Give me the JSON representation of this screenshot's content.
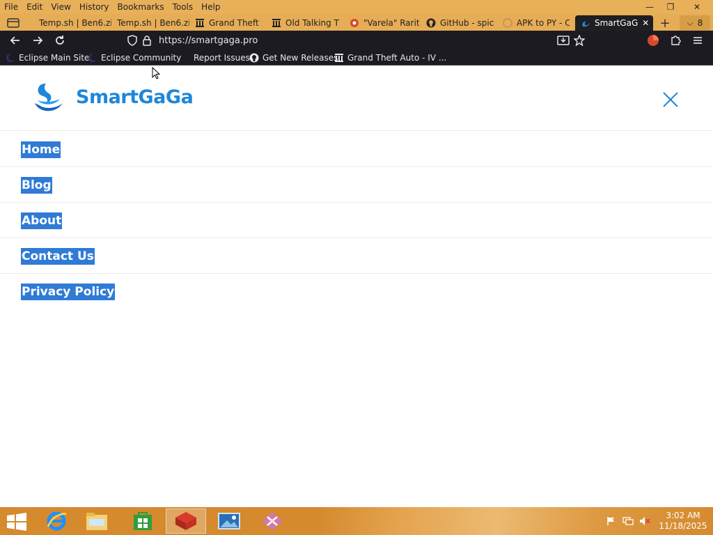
{
  "browser": {
    "menu": [
      "File",
      "Edit",
      "View",
      "History",
      "Bookmarks",
      "Tools",
      "Help"
    ],
    "window_controls": {
      "minimize": "—",
      "restore": "❐",
      "close": "✕"
    },
    "tabs": [
      {
        "title": "Temp.sh | Ben6.zi",
        "icon": "none"
      },
      {
        "title": "Temp.sh | Ben6.zi",
        "icon": "none"
      },
      {
        "title": "Grand Theft A",
        "icon": "archive-icon"
      },
      {
        "title": "Old Talking T",
        "icon": "archive-icon"
      },
      {
        "title": "\"Varela\" Rarit",
        "icon": "record-icon"
      },
      {
        "title": "GitHub - spic",
        "icon": "github-icon"
      },
      {
        "title": "APK to PY - C",
        "icon": "globe-icon"
      },
      {
        "title": "SmartGaG",
        "icon": "swan-icon",
        "active": true
      }
    ],
    "new_tab": "+",
    "tab_count": "8",
    "url": "https://smartgaga.pro",
    "bookmarks": [
      {
        "label": "Eclipse Main Site",
        "icon": "eclipse-icon"
      },
      {
        "label": "Eclipse Community",
        "icon": "eclipse-icon"
      },
      {
        "label": "Report Issues",
        "icon": "none"
      },
      {
        "label": "Get New Releases",
        "icon": "github-icon"
      },
      {
        "label": "Grand Theft Auto - IV ...",
        "icon": "archive-icon"
      }
    ]
  },
  "site": {
    "logo_text": "SmartGaGa",
    "brand_color": "#1e87d9",
    "nav": [
      {
        "label": "Home"
      },
      {
        "label": "Blog"
      },
      {
        "label": "About"
      },
      {
        "label": "Contact Us"
      },
      {
        "label": "Privacy Policy"
      }
    ],
    "selection_color": "#2f7bd6"
  },
  "taskbar": {
    "apps": [
      "internet-explorer-icon",
      "file-explorer-icon",
      "store-icon",
      "app-red-icon",
      "photos-icon",
      "app-pink-icon"
    ],
    "clock": {
      "time": "3:02 AM",
      "date": "11/18/2025"
    }
  }
}
